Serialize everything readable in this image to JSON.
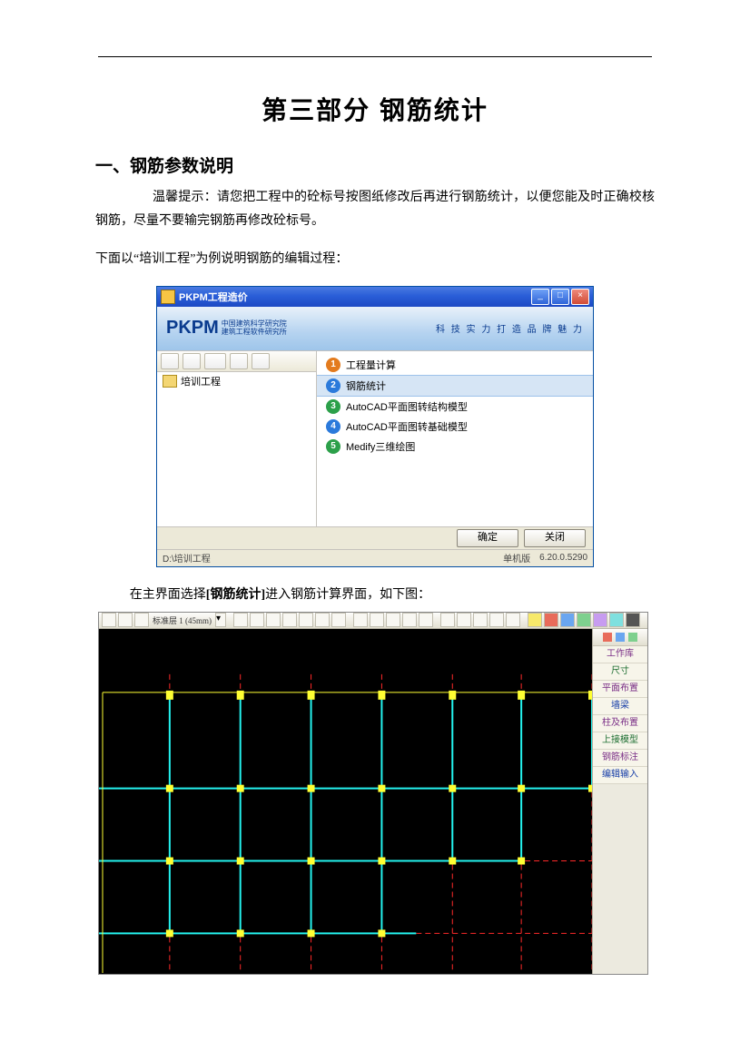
{
  "doc": {
    "title": "第三部分  钢筋统计",
    "heading1": "一、钢筋参数说明",
    "p1": "温馨提示：请您把工程中的砼标号按图纸修改后再进行钢筋统计，以便您能及时正确校核钢筋，尽量不要输完钢筋再修改砼标号。",
    "p2": "下面以“培训工程”为例说明钢筋的编辑过程：",
    "caption2_pre": "在主界面选择",
    "caption2_bold": "[钢筋统计]",
    "caption2_post": "进入钢筋计算界面，如下图："
  },
  "pkpm": {
    "title": "PKPM工程造价",
    "logo": "PKPM",
    "logo_sub1": "中国建筑科学研究院",
    "logo_sub2": "建筑工程软件研究所",
    "banner_right": "科 技 实 力    打 造 品 牌 魅 力",
    "tree_item": "培训工程",
    "menu": [
      "工程量计算",
      "钢筋统计",
      "AutoCAD平面图转结构模型",
      "AutoCAD平面图转基础模型",
      "Medify三维绘图"
    ],
    "btn_ok": "确定",
    "btn_cancel": "关闭",
    "status_left": "D:\\培训工程",
    "status_mid": "单机版",
    "status_right": "6.20.0.5290"
  },
  "cad": {
    "side": [
      "工作库",
      "尺寸",
      "平面布置",
      "墙梁",
      "柱及布置",
      "上接模型",
      "钢筋标注",
      "编辑输入"
    ]
  }
}
